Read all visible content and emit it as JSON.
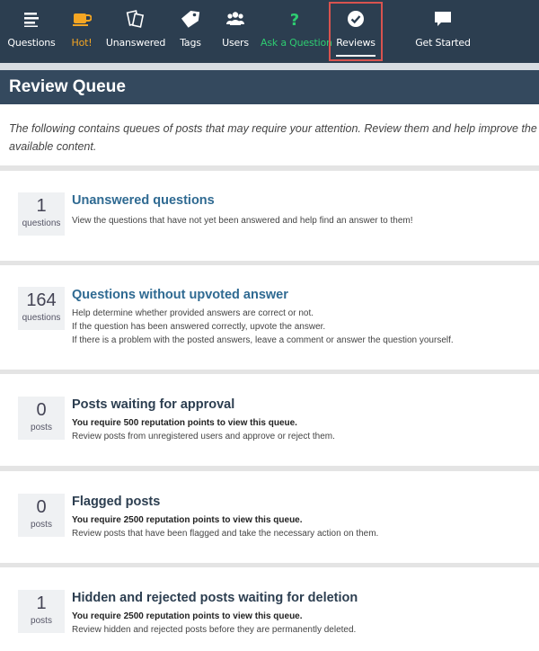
{
  "nav": {
    "items": [
      {
        "label": "Questions",
        "icon": "list-icon"
      },
      {
        "label": "Hot!",
        "icon": "coffee-cup-icon"
      },
      {
        "label": "Unanswered",
        "icon": "unanswered-cards-icon"
      },
      {
        "label": "Tags",
        "icon": "tag-icon"
      },
      {
        "label": "Users",
        "icon": "users-icon"
      },
      {
        "label": "Ask a Question",
        "icon": "question-mark-icon"
      },
      {
        "label": "Reviews",
        "icon": "check-circle-icon"
      },
      {
        "label": "Get Started",
        "icon": "speech-bubble-icon"
      }
    ],
    "active": "Reviews"
  },
  "colors": {
    "nav_bg": "#2c3e50",
    "header_bg": "#34495e",
    "hot": "#f5a623",
    "ask": "#2ecc71",
    "link": "#2f6a92",
    "highlight": "#d9534f"
  },
  "page": {
    "title": "Review Queue",
    "intro_line1": "The following contains queues of posts that may require your attention. Review them and help improve the qua",
    "intro_line2": "available content."
  },
  "queues": [
    {
      "count": "1",
      "unit": "questions",
      "title": "Unanswered questions",
      "lines": [
        "View the questions that have not yet been answered and help find an answer to them!"
      ]
    },
    {
      "count": "164",
      "unit": "questions",
      "title": "Questions without upvoted answer",
      "lines": [
        "Help determine whether provided answers are correct or not.",
        "If the question has been answered correctly, upvote the answer.",
        "If there is a problem with the posted answers, leave a comment or answer the question yourself."
      ]
    },
    {
      "count": "0",
      "unit": "posts",
      "title": "Posts waiting for approval",
      "requirement": "You require 500 reputation points to view this queue.",
      "lines": [
        "Review posts from unregistered users and approve or reject them."
      ]
    },
    {
      "count": "0",
      "unit": "posts",
      "title": "Flagged posts",
      "requirement": "You require 2500 reputation points to view this queue.",
      "lines": [
        "Review posts that have been flagged and take the necessary action on them."
      ]
    },
    {
      "count": "1",
      "unit": "posts",
      "title": "Hidden and rejected posts waiting for deletion",
      "requirement": "You require 2500 reputation points to view this queue.",
      "lines": [
        "Review hidden and rejected posts before they are permanently deleted."
      ]
    }
  ]
}
